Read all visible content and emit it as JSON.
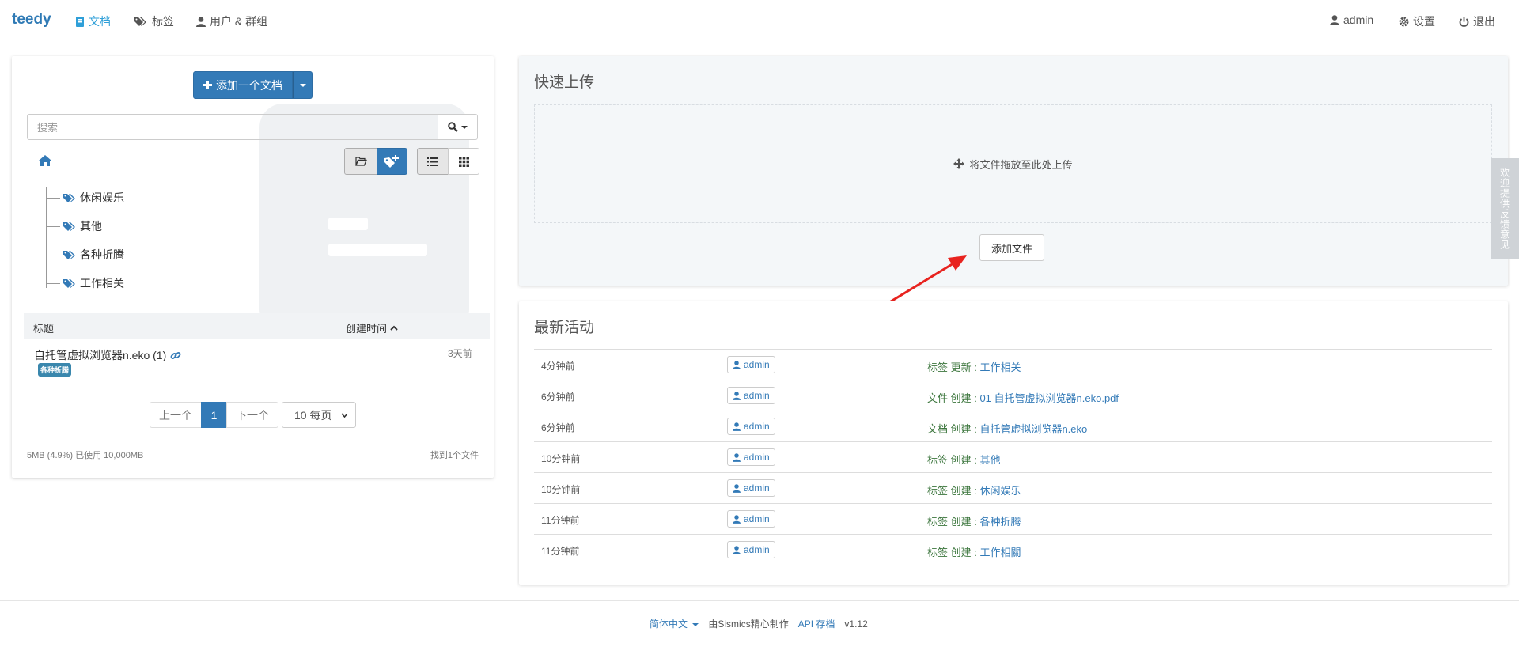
{
  "nav": {
    "brand": "teedy",
    "documents": "文档",
    "tags": "标签",
    "users_groups": "用户 & 群组",
    "user": "admin",
    "settings": "设置",
    "logout": "退出"
  },
  "left": {
    "add_document": "添加一个文档",
    "search_placeholder": "搜索",
    "tags": [
      "休闲娱乐",
      "其他",
      "各种折腾",
      "工作相关"
    ],
    "table_headers": {
      "title": "标题",
      "created": "创建时间"
    },
    "documents": [
      {
        "title": "自托管虚拟浏览器n.eko (1)",
        "tag": "各种折腾",
        "date": "3天前"
      }
    ],
    "pagination": {
      "prev": "上一个",
      "page": "1",
      "next": "下一个",
      "per_page": "10 每页"
    },
    "quota": "5MB (4.9%) 已使用 10,000MB",
    "found": "找到1个文件"
  },
  "upload": {
    "title": "快速上传",
    "drop_hint": "将文件拖放至此处上传",
    "add_file": "添加文件"
  },
  "activity": {
    "title": "最新活动",
    "rows": [
      {
        "time": "4分钟前",
        "user": "admin",
        "action": "标签 更新 : ",
        "target": "工作相关"
      },
      {
        "time": "6分钟前",
        "user": "admin",
        "action": "文件 创建 : ",
        "target": "01 自托管虚拟浏览器n.eko.pdf"
      },
      {
        "time": "6分钟前",
        "user": "admin",
        "action": "文档 创建 : ",
        "target": "自托管虚拟浏览器n.eko"
      },
      {
        "time": "10分钟前",
        "user": "admin",
        "action": "标签 创建 : ",
        "target": "其他"
      },
      {
        "time": "10分钟前",
        "user": "admin",
        "action": "标签 创建 : ",
        "target": "休闲娱乐"
      },
      {
        "time": "11分钟前",
        "user": "admin",
        "action": "标签 创建 : ",
        "target": "各种折腾"
      },
      {
        "time": "11分钟前",
        "user": "admin",
        "action": "标签 创建 : ",
        "target": "工作相關"
      }
    ]
  },
  "footer": {
    "language": "简体中文",
    "made_by": "由Sismics精心制作",
    "api": "API 存档",
    "version": "v1.12"
  },
  "feedback": "欢迎提供反馈意见",
  "colors": {
    "primary": "#337ab7",
    "brand": "#2f7ab5",
    "success_text": "#3c763d",
    "tag_badge": "#3a87ad"
  }
}
